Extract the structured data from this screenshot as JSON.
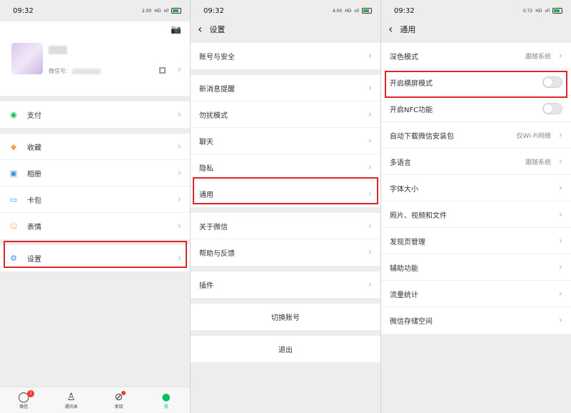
{
  "status_bar": {
    "time": "09:32",
    "net_speeds": [
      "2.00",
      "4.00",
      "0.72"
    ],
    "net_unit": "KB/S",
    "hd": "HD"
  },
  "panel_me": {
    "wechat_id_label": "微信号:",
    "items_group1": [
      {
        "label": "支付",
        "icon": "wechat-pay-icon",
        "color": "#07c160"
      }
    ],
    "items_group2": [
      {
        "label": "收藏",
        "icon": "favorites-cube-icon",
        "color": "#f2a64a"
      },
      {
        "label": "相册",
        "icon": "photo-album-icon",
        "color": "#3b8fe5"
      },
      {
        "label": "卡包",
        "icon": "card-wallet-icon",
        "color": "#3b8fe5"
      },
      {
        "label": "表情",
        "icon": "sticker-face-icon",
        "color": "#f6c343"
      }
    ],
    "items_group3": [
      {
        "label": "设置",
        "icon": "gear-icon",
        "color": "#3b8fe5"
      }
    ],
    "tabs": [
      {
        "label": "微信",
        "icon": "chat-bubble-icon",
        "badge": "1"
      },
      {
        "label": "通讯录",
        "icon": "contacts-icon",
        "badge": ""
      },
      {
        "label": "发现",
        "icon": "compass-icon",
        "badge": ""
      },
      {
        "label": "我",
        "icon": "person-icon",
        "badge": ""
      }
    ]
  },
  "panel_settings": {
    "title": "设置",
    "group1": [
      "账号与安全"
    ],
    "group2": [
      "新消息提醒",
      "勿扰模式",
      "聊天",
      "隐私",
      "通用"
    ],
    "group3": [
      "关于微信",
      "帮助与反馈"
    ],
    "group4": [
      "插件"
    ],
    "switch_account": "切换账号",
    "logout": "退出"
  },
  "panel_general": {
    "title": "通用",
    "rows": [
      {
        "label": "深色模式",
        "value": "跟随系统",
        "type": "link"
      },
      {
        "label": "开启横屏模式",
        "value": "",
        "type": "toggle"
      },
      {
        "label": "开启NFC功能",
        "value": "",
        "type": "toggle"
      },
      {
        "label": "自动下载微信安装包",
        "value": "仅Wi-Fi网络",
        "type": "link"
      },
      {
        "label": "多语言",
        "value": "跟随系统",
        "type": "link"
      },
      {
        "label": "字体大小",
        "value": "",
        "type": "link"
      },
      {
        "label": "照片、视频和文件",
        "value": "",
        "type": "link"
      },
      {
        "label": "发现页管理",
        "value": "",
        "type": "link"
      },
      {
        "label": "辅助功能",
        "value": "",
        "type": "link"
      },
      {
        "label": "流量统计",
        "value": "",
        "type": "link"
      },
      {
        "label": "微信存储空间",
        "value": "",
        "type": "link"
      }
    ]
  },
  "colors": {
    "highlight": "#d9262a",
    "accent": "#07c160",
    "background": "#ededed"
  }
}
